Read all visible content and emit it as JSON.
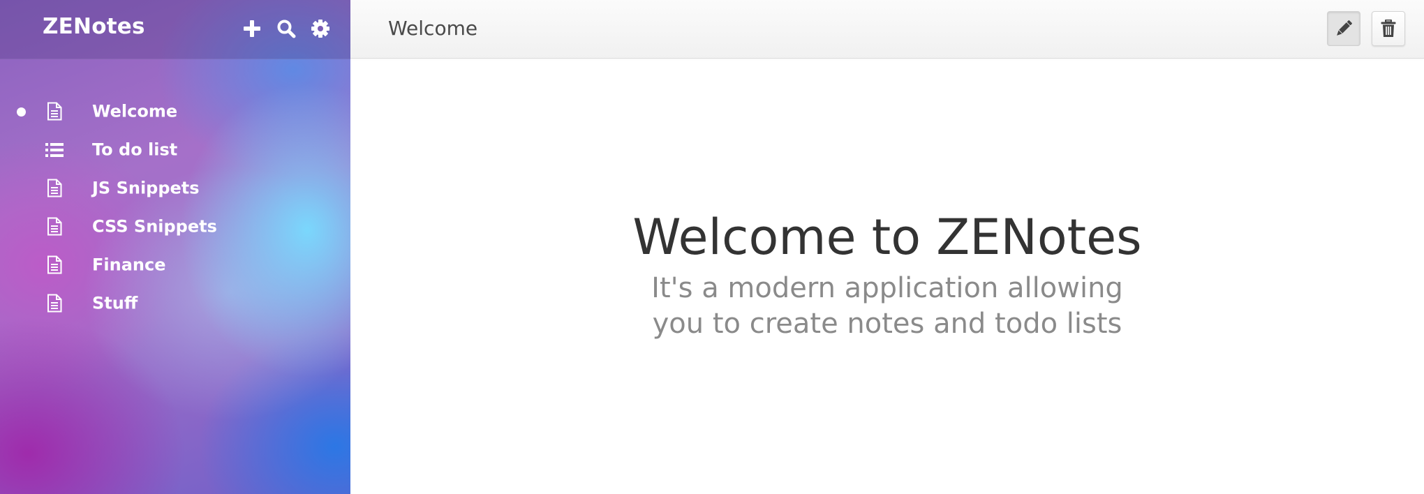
{
  "app": {
    "title": "ZENotes"
  },
  "sidebar": {
    "header_buttons": [
      {
        "name": "add",
        "icon": "plus-icon"
      },
      {
        "name": "search",
        "icon": "search-icon"
      },
      {
        "name": "settings",
        "icon": "gear-icon"
      }
    ],
    "notes": [
      {
        "label": "Welcome",
        "icon": "document-icon",
        "active": true
      },
      {
        "label": "To do list",
        "icon": "list-icon",
        "active": false
      },
      {
        "label": "JS Snippets",
        "icon": "document-icon",
        "active": false
      },
      {
        "label": "CSS Snippets",
        "icon": "document-icon",
        "active": false
      },
      {
        "label": "Finance",
        "icon": "document-icon",
        "active": false
      },
      {
        "label": "Stuff",
        "icon": "document-icon",
        "active": false
      }
    ]
  },
  "main": {
    "note_title": "Welcome",
    "toolbar": {
      "edit_icon": "pencil-icon",
      "delete_icon": "trash-icon"
    },
    "content": {
      "heading": "Welcome to ZENotes",
      "subheading": "It's a modern application allowing you to create notes and todo lists"
    }
  },
  "colors": {
    "sidebar_text": "#ffffff",
    "heading_text": "#333333",
    "subheading_text": "#8a8a8a",
    "topbar_bg": "#f4f4f4"
  }
}
